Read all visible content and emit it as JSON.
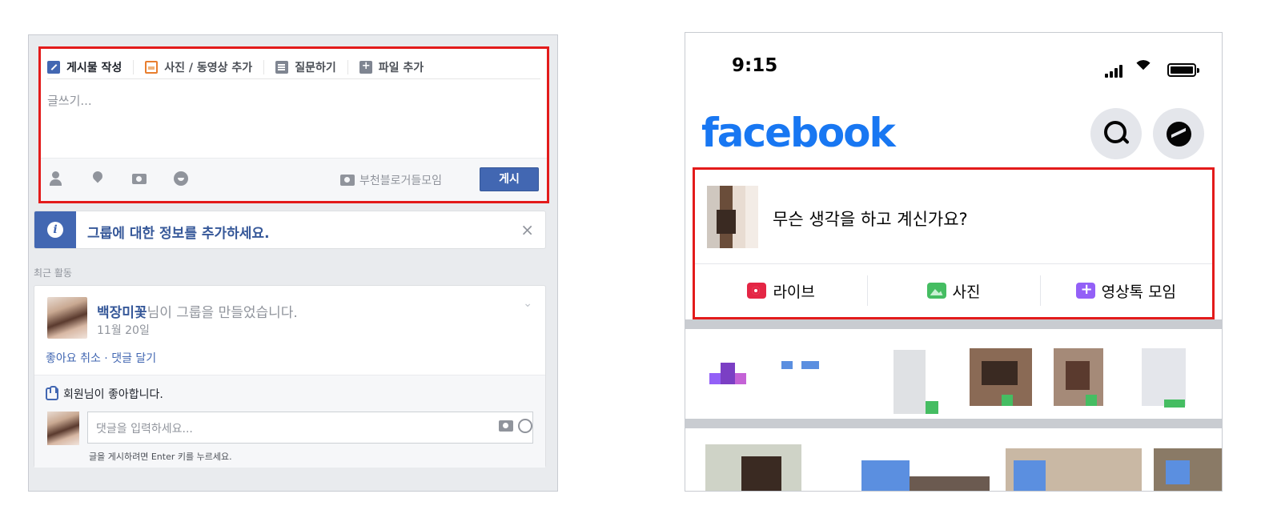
{
  "left_panel": {
    "composer": {
      "tabs": [
        {
          "label": "게시물 작성",
          "icon": "pencil-icon"
        },
        {
          "label": "사진 / 동영상 추가",
          "icon": "photo-icon"
        },
        {
          "label": "질문하기",
          "icon": "question-icon"
        },
        {
          "label": "파일 추가",
          "icon": "file-add-icon"
        }
      ],
      "placeholder": "글쓰기...",
      "group_name": "부천블로거들모임",
      "post_label": "게시"
    },
    "info_bar": {
      "text": "그룹에 대한 정보를 추가하세요.",
      "close": "×"
    },
    "recent_label": "최근 활동",
    "activity": {
      "user": "백장미꽃",
      "message": "님이 그룹을 만들었습니다.",
      "date": "11월 20일",
      "chevron": "⌄",
      "links": "좋아요 취소 · 댓글 달기",
      "likes_text": "회원님이 좋아합니다.",
      "comment_placeholder": "댓글을 입력하세요...",
      "comment_hint": "글을 게시하려면 Enter 키를 누르세요."
    }
  },
  "right_panel": {
    "status_bar": {
      "time": "9:15"
    },
    "logo": "facebook",
    "composer": {
      "prompt": "무슨 생각을 하고 계신가요?",
      "actions": [
        {
          "label": "라이브",
          "icon": "live-video-icon",
          "color": "#e42645"
        },
        {
          "label": "사진",
          "icon": "photo-icon",
          "color": "#45bd62"
        },
        {
          "label": "영상톡 모임",
          "icon": "video-room-icon",
          "color": "#9360f7"
        }
      ]
    }
  },
  "colors": {
    "highlight_border": "#e31b1b",
    "fb_blue": "#1877f2",
    "desktop_blue": "#4267b2"
  }
}
